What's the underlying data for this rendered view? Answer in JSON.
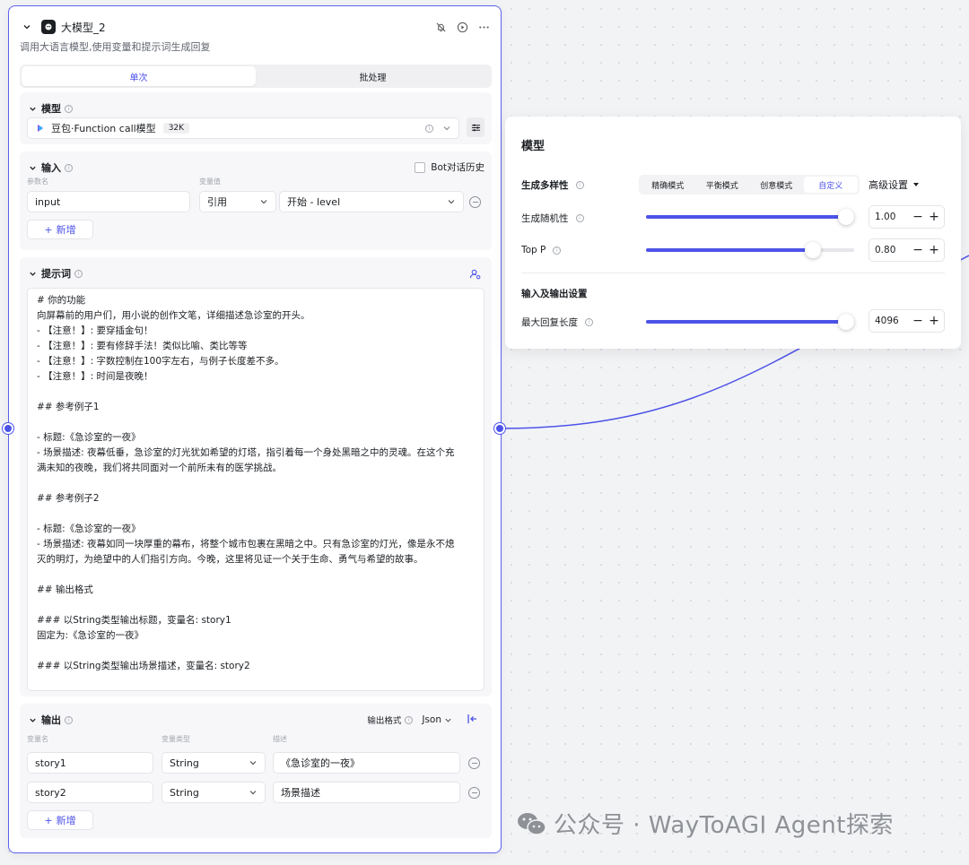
{
  "node": {
    "title": "大模型_2",
    "description": "调用大语言模型,使用变量和提示词生成回复",
    "tabs": [
      {
        "label": "单次",
        "active": true
      },
      {
        "label": "批处理",
        "active": false
      }
    ]
  },
  "model_section": {
    "title": "模型",
    "model_name": "豆包·Function call模型",
    "context_badge": "32K"
  },
  "input_section": {
    "title": "输入",
    "bot_history_label": "Bot对话历史",
    "col_param": "参数名",
    "col_value": "变量值",
    "row": {
      "name": "input",
      "ref_type": "引用",
      "ref_value": "开始 - level"
    },
    "add_label": "新增"
  },
  "prompt_section": {
    "title": "提示词",
    "lines": [
      "# 你的功能",
      "向屏幕前的用户们，用小说的创作文笔，详细描述急诊室的开头。",
      "- 【注意！】: 要穿插金句！",
      "- 【注意！】: 要有修辞手法！类似比喻、类比等等",
      "- 【注意！】: 字数控制在100字左右，与例子长度差不多。",
      "- 【注意！】: 时间是夜晚！",
      "",
      "## 参考例子1",
      "",
      "- 标题:《急诊室的一夜》",
      "- 场景描述: 夜幕低垂，急诊室的灯光犹如希望的灯塔，指引着每一个身处黑暗之中的灵魂。在这个充",
      "满未知的夜晚，我们将共同面对一个前所未有的医学挑战。",
      "",
      "## 参考例子2",
      "",
      "- 标题:《急诊室的一夜》",
      "- 场景描述: 夜幕如同一块厚重的幕布，将整个城市包裹在黑暗之中。只有急诊室的灯光，像是永不熄",
      "灭的明灯，为绝望中的人们指引方向。今晚，这里将见证一个关于生命、勇气与希望的故事。",
      "",
      "## 输出格式",
      "",
      "### 以String类型输出标题，变量名: story1",
      "固定为:《急诊室的一夜》",
      "",
      "### 以String类型输出场景描述，变量名: story2"
    ]
  },
  "output_section": {
    "title": "输出",
    "format_label": "输出格式",
    "format_value": "Json",
    "col_name": "变量名",
    "col_type": "变量类型",
    "col_desc": "描述",
    "rows": [
      {
        "name": "story1",
        "type": "String",
        "desc": "《急诊室的一夜》"
      },
      {
        "name": "story2",
        "type": "String",
        "desc": "场景描述"
      }
    ],
    "add_label": "新增"
  },
  "model_panel": {
    "title": "模型",
    "diversity_label": "生成多样性",
    "modes": [
      {
        "label": "精确模式",
        "active": false
      },
      {
        "label": "平衡模式",
        "active": false
      },
      {
        "label": "创意模式",
        "active": false
      },
      {
        "label": "自定义",
        "active": true
      }
    ],
    "advanced_label": "高级设置",
    "temperature": {
      "label": "生成随机性",
      "value": "1.00",
      "level": 1.0
    },
    "top_p": {
      "label": "Top P",
      "value": "0.80",
      "level": 0.8
    },
    "io_title": "输入及输出设置",
    "max_tokens": {
      "label": "最大回复长度",
      "value": "4096",
      "level": 1.0
    }
  },
  "watermark": "公众号 · WayToAGI Agent探索",
  "colors": {
    "accent": "#4d53e8",
    "border": "#5c62f0"
  }
}
